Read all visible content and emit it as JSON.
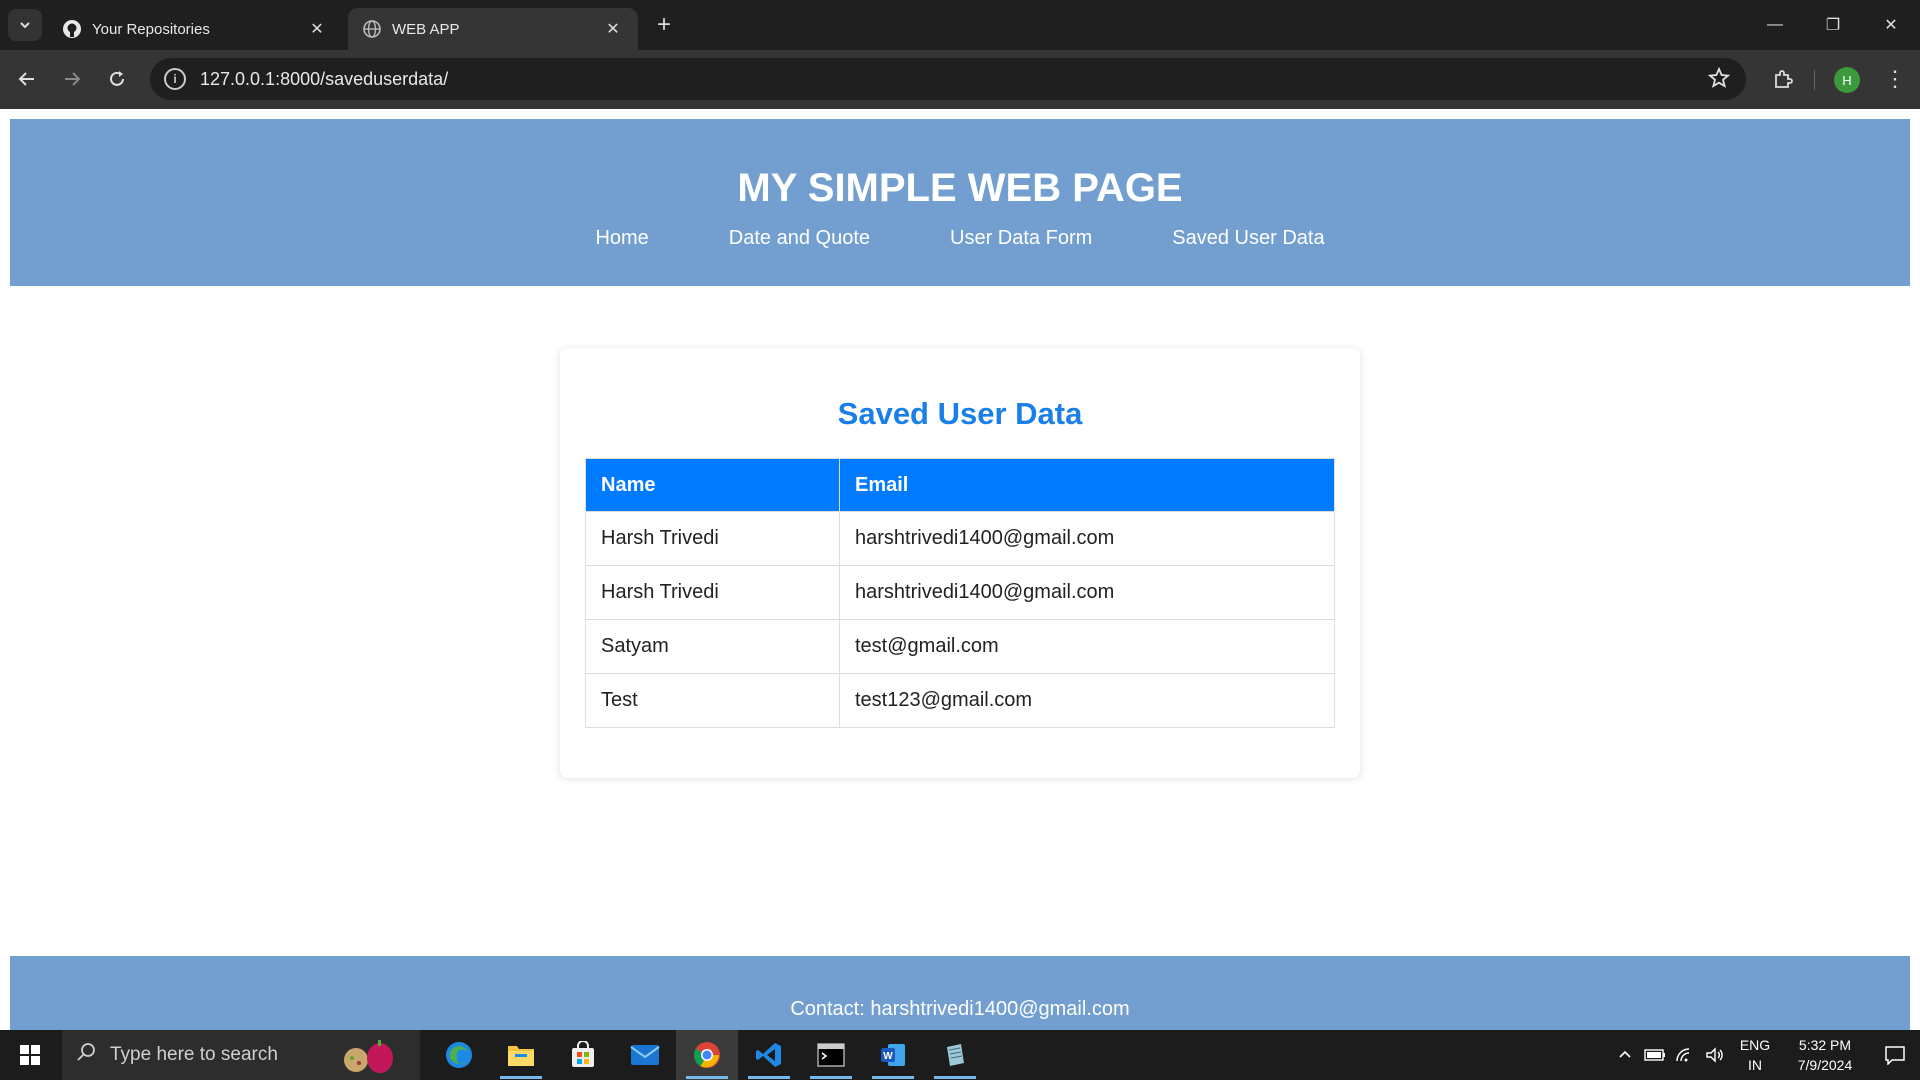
{
  "browser": {
    "tabs": [
      {
        "title": "Your Repositories",
        "icon": "github-icon",
        "active": false
      },
      {
        "title": "WEB APP",
        "icon": "globe-icon",
        "active": true
      }
    ],
    "url": "127.0.0.1:8000/saveduserdata/",
    "profile_initial": "H",
    "profile_color": "#3c9a3c"
  },
  "page": {
    "site_title": "MY SIMPLE WEB PAGE",
    "nav": [
      "Home",
      "Date and Quote",
      "User Data Form",
      "Saved User Data"
    ],
    "header_color": "#729fcf",
    "card_title": "Saved User Data",
    "table": {
      "headers": [
        "Name",
        "Email"
      ],
      "rows": [
        [
          "Harsh Trivedi",
          "harshtrivedi1400@gmail.com"
        ],
        [
          "Harsh Trivedi",
          "harshtrivedi1400@gmail.com"
        ],
        [
          "Satyam",
          "test@gmail.com"
        ],
        [
          "Test",
          "test123@gmail.com"
        ]
      ],
      "header_color": "#007bff"
    },
    "footer_text": "Contact: harshtrivedi1400@gmail.com"
  },
  "taskbar": {
    "search_placeholder": "Type here to search",
    "apps": [
      "edge-icon",
      "file-explorer-icon",
      "store-icon",
      "mail-icon",
      "chrome-icon",
      "vscode-icon",
      "terminal-icon",
      "word-icon",
      "notepad-icon"
    ],
    "language": "ENG",
    "region": "IN",
    "time": "5:32 PM",
    "date": "7/9/2024"
  }
}
